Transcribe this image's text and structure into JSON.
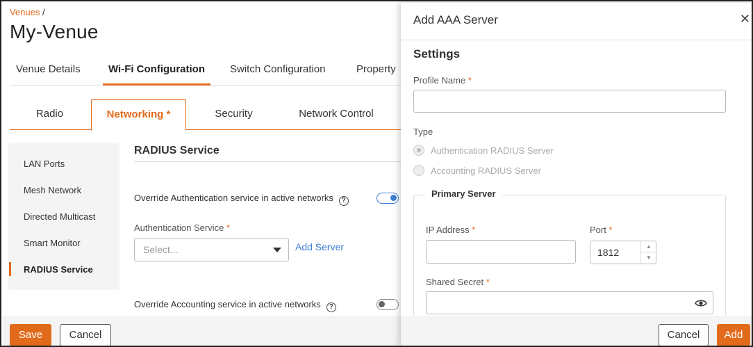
{
  "breadcrumb": {
    "link": "Venues",
    "separator": "/"
  },
  "page": {
    "title": "My-Venue"
  },
  "top_tabs": [
    {
      "label": "Venue Details"
    },
    {
      "label": "Wi-Fi Configuration"
    },
    {
      "label": "Switch Configuration"
    },
    {
      "label": "Property"
    }
  ],
  "sub_tabs": [
    {
      "label": "Radio"
    },
    {
      "label": "Networking *"
    },
    {
      "label": "Security"
    },
    {
      "label": "Network Control"
    }
  ],
  "side_nav": [
    {
      "label": "LAN Ports"
    },
    {
      "label": "Mesh Network"
    },
    {
      "label": "Directed Multicast"
    },
    {
      "label": "Smart Monitor"
    },
    {
      "label": "RADIUS Service"
    }
  ],
  "radius": {
    "title": "RADIUS Service",
    "override_auth_label": "Override Authentication service in active networks",
    "override_auth_on": true,
    "auth_service_label": "Authentication Service",
    "required_mark": "*",
    "auth_select_placeholder": "Select...",
    "add_server_link": "Add Server",
    "override_acct_label": "Override Accounting service in active networks",
    "override_acct_on": false
  },
  "help_glyph": "?",
  "footer": {
    "save": "Save",
    "cancel": "Cancel"
  },
  "drawer": {
    "title": "Add AAA Server",
    "close_glyph": "✕",
    "settings_heading": "Settings",
    "profile_name_label": "Profile Name",
    "profile_name_value": "",
    "type_label": "Type",
    "type_options": [
      {
        "label": "Authentication RADIUS Server",
        "checked": true
      },
      {
        "label": "Accounting RADIUS Server",
        "checked": false
      }
    ],
    "primary_server_heading": "Primary Server",
    "ip_label": "IP Address",
    "ip_value": "",
    "port_label": "Port",
    "port_value": "1812",
    "shared_secret_label": "Shared Secret",
    "shared_secret_value": "",
    "cancel": "Cancel",
    "add": "Add"
  },
  "colors": {
    "accent": "#e26a1b",
    "link": "#3b7bd4"
  }
}
